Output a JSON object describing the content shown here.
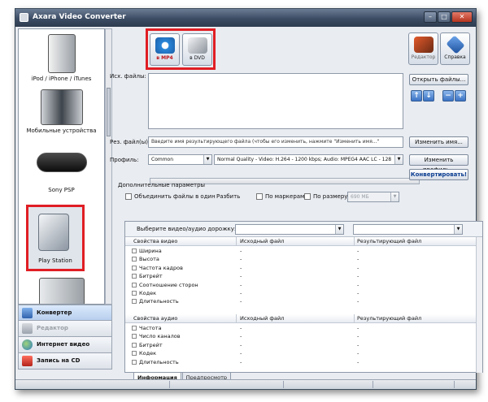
{
  "window": {
    "title": "Axara Video Converter"
  },
  "sidebar": {
    "devices": [
      {
        "label": "iPod / iPhone / iTunes"
      },
      {
        "label": "Мобильные устройства"
      },
      {
        "label": "Sony PSP"
      },
      {
        "label": "Play Station"
      },
      {
        "label": ""
      }
    ],
    "nav": [
      {
        "label": "Конвертер",
        "state": "active"
      },
      {
        "label": "Редактор",
        "state": "disabled"
      },
      {
        "label": "Интернет видео",
        "state": "normal"
      },
      {
        "label": "Запись на CD",
        "state": "normal"
      }
    ]
  },
  "toolbar": {
    "mp4_label": "в MP4",
    "dvd_label": "в DVD",
    "editor_label": "Редактор",
    "help_label": "Справка"
  },
  "files": {
    "source_label": "Исх. файлы:",
    "open_button": "Открыть файлы...",
    "result_label": "Рез. файл(ы):",
    "result_placeholder": "Введите имя результирующего файла (чтобы его изменить, нажмите \"Изменить имя...\"",
    "rename_button": "Изменить имя..."
  },
  "profile": {
    "label": "Профиль:",
    "value": "Common",
    "quality": "Normal Quality - Video: H.264 - 1200 kbps; Audio: MPEG4 AAC LC - 128",
    "change_button": "Изменить профиль...",
    "convert_button": "Конвертировать!"
  },
  "extra": {
    "group_label": "Дополнительные параметры",
    "merge_label": "Объединить файлы в один",
    "split_label": "Разбить",
    "markers_label": "По маркерам",
    "size_label": "По размеру:",
    "size_value": "690 МБ"
  },
  "properties": {
    "track_label": "Выберите видео/аудио дорожку:",
    "video_header": [
      "Свойства видео",
      "Исходный файл",
      "Результирующий файл"
    ],
    "video_rows": [
      {
        "name": "Ширина",
        "src": "-",
        "dst": "-"
      },
      {
        "name": "Высота",
        "src": "-",
        "dst": "-"
      },
      {
        "name": "Частота кадров",
        "src": "-",
        "dst": "-"
      },
      {
        "name": "Битрейт",
        "src": "-",
        "dst": "-"
      },
      {
        "name": "Соотношение сторон",
        "src": "-",
        "dst": "-"
      },
      {
        "name": "Кодек",
        "src": "-",
        "dst": "-"
      },
      {
        "name": "Длительность",
        "src": "-",
        "dst": "-"
      }
    ],
    "audio_header": [
      "Свойства аудио",
      "Исходный файл",
      "Результирующий файл"
    ],
    "audio_rows": [
      {
        "name": "Частота",
        "src": "-",
        "dst": "-"
      },
      {
        "name": "Число каналов",
        "src": "-",
        "dst": "-"
      },
      {
        "name": "Битрейт",
        "src": "-",
        "dst": "-"
      },
      {
        "name": "Кодек",
        "src": "-",
        "dst": "-"
      },
      {
        "name": "Длительность",
        "src": "-",
        "dst": "-"
      }
    ]
  },
  "tabs": [
    {
      "label": "Информация",
      "active": true
    },
    {
      "label": "Предпросмотр",
      "active": false
    }
  ],
  "colors": {
    "highlight": "#e01e24",
    "accent": "#3a72c4",
    "titlebar": "#3c4c63"
  }
}
